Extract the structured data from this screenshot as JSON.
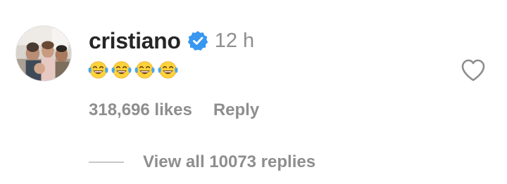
{
  "comment": {
    "username": "cristiano",
    "verified": true,
    "timestamp": "12 h",
    "emojis": [
      "face-with-tears-of-joy",
      "face-with-tears-of-joy",
      "face-with-tears-of-joy",
      "face-with-tears-of-joy"
    ],
    "likes_label": "318,696 likes",
    "reply_label": "Reply",
    "view_replies_label": "View all 10073 replies",
    "liked": false
  },
  "colors": {
    "username": "#262626",
    "secondary_text": "#8e8e8e",
    "verified_badge": "#3897f0",
    "divider": "#c7c7c7",
    "emoji_face": "#fdd33b",
    "emoji_tears": "#4aa6ea"
  }
}
